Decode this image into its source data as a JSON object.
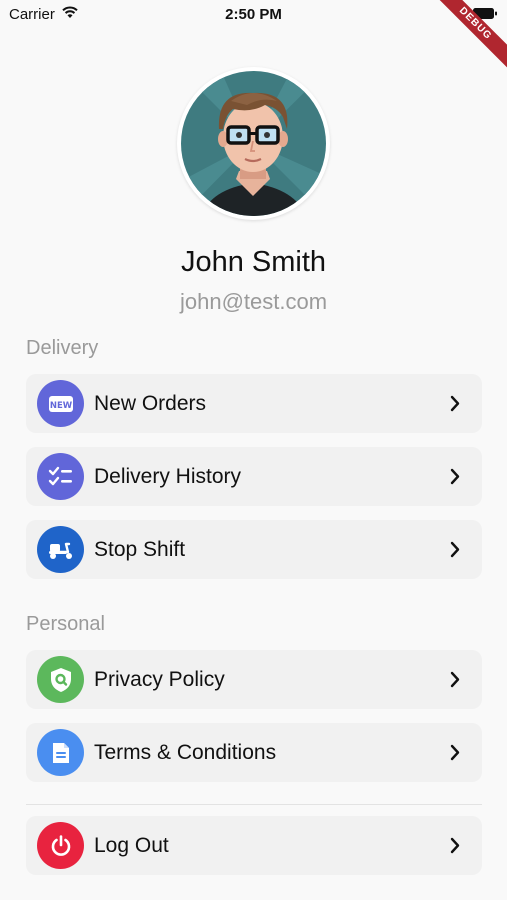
{
  "status_bar": {
    "carrier": "Carrier",
    "time": "2:50 PM"
  },
  "debug_banner": "DEBUG",
  "profile": {
    "name": "John Smith",
    "email": "john@test.com"
  },
  "sections": {
    "delivery": {
      "title": "Delivery",
      "items": [
        {
          "label": "New Orders",
          "icon": "new-badge-icon",
          "color": "#6166d9"
        },
        {
          "label": "Delivery History",
          "icon": "checklist-icon",
          "color": "#6166d9"
        },
        {
          "label": "Stop Shift",
          "icon": "scooter-icon",
          "color": "#1f64c9"
        }
      ]
    },
    "personal": {
      "title": "Personal",
      "items": [
        {
          "label": "Privacy Policy",
          "icon": "shield-search-icon",
          "color": "#5cb85c"
        },
        {
          "label": "Terms & Conditions",
          "icon": "document-icon",
          "color": "#4a8ef0"
        }
      ]
    },
    "account": {
      "items": [
        {
          "label": "Log Out",
          "icon": "power-icon",
          "color": "#e8233f"
        }
      ]
    }
  }
}
